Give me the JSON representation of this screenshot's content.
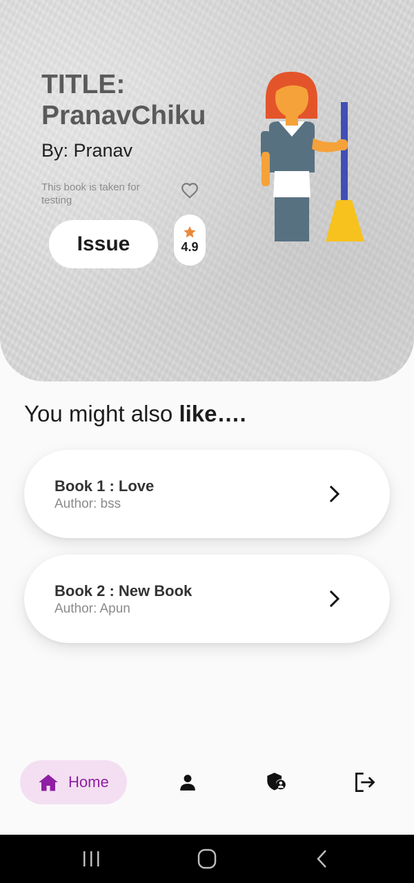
{
  "hero": {
    "title": "TITLE: PranavChiku",
    "author": "By: Pranav",
    "description": "This book is taken for testing",
    "issue_label": "Issue",
    "rating": "4.9",
    "favorite_icon": "heart-outline-icon",
    "rating_icon": "star-icon",
    "illustration": "cleaning-lady-with-broom-illustration"
  },
  "recommendations": {
    "heading_prefix": "You might also ",
    "heading_bold": "like….",
    "books": [
      {
        "title": "Book 1 : Love",
        "author": "Author: bss"
      },
      {
        "title": "Book 2 : New Book",
        "author": "Author: Apun"
      }
    ]
  },
  "bottom_nav": {
    "home_label": "Home",
    "items": [
      "home-icon",
      "person-icon",
      "admin-shield-icon",
      "logout-icon"
    ]
  },
  "colors": {
    "accent": "#8f1fa3",
    "home_pill": "#f3dff1",
    "star": "#e8893a",
    "hero_bg": "#d7d7d7"
  }
}
